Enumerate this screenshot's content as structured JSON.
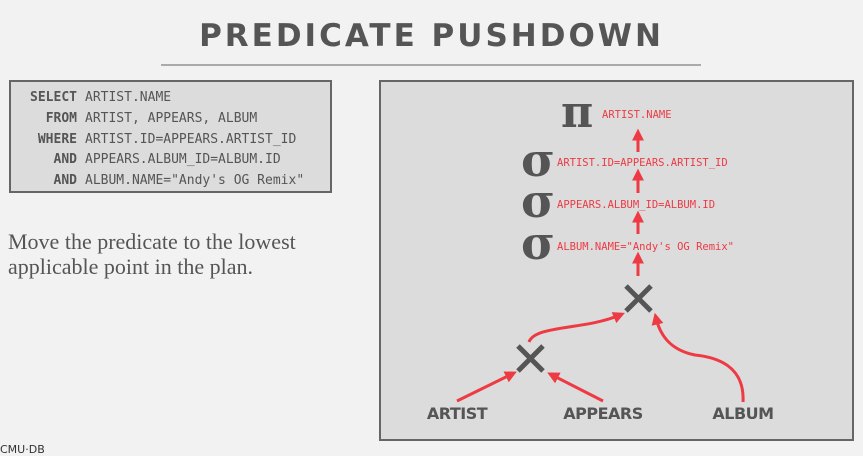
{
  "title": "PREDICATE PUSHDOWN",
  "sql": [
    {
      "kw": "SELECT",
      "text": "ARTIST.NAME"
    },
    {
      "kw": "FROM",
      "text": "ARTIST, APPEARS, ALBUM"
    },
    {
      "kw": "WHERE",
      "text": "ARTIST.ID=APPEARS.ARTIST_ID"
    },
    {
      "kw": "AND",
      "text": "APPEARS.ALBUM_ID=ALBUM.ID"
    },
    {
      "kw": "AND",
      "text": "ALBUM.NAME=\"Andy's OG Remix\""
    }
  ],
  "description": "Move the predicate to the lowest applicable point in the plan.",
  "plan": {
    "projection": {
      "symbol": "π",
      "label": "ARTIST.NAME"
    },
    "selections": [
      {
        "symbol": "σ",
        "label": "ARTIST.ID=APPEARS.ARTIST_ID"
      },
      {
        "symbol": "σ",
        "label": "APPEARS.ALBUM_ID=ALBUM.ID"
      },
      {
        "symbol": "σ",
        "label": "ALBUM.NAME=\"Andy's OG Remix\""
      }
    ],
    "join_symbol": "×",
    "tables": [
      "ARTIST",
      "APPEARS",
      "ALBUM"
    ]
  },
  "colors": {
    "accent": "#ee3a43",
    "operator": "#555555",
    "panel": "#dcdcdc"
  },
  "footer": "CMU·DB"
}
